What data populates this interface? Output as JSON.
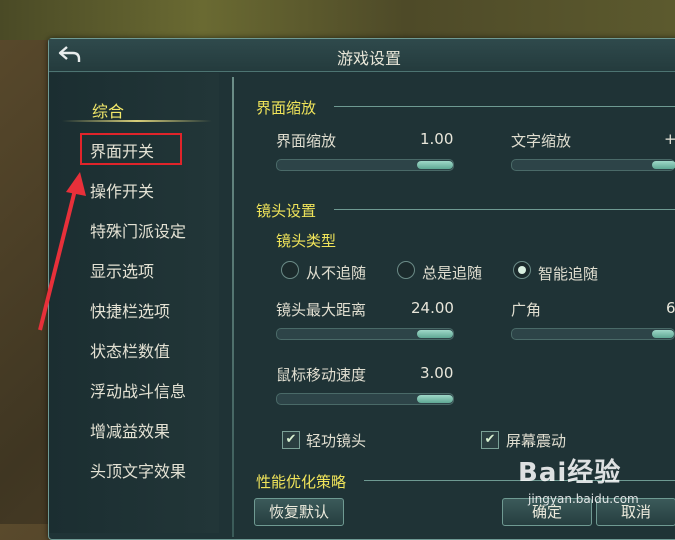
{
  "window": {
    "title": "游戏设置"
  },
  "sidebar": {
    "items": [
      {
        "label": "综合",
        "active": true
      },
      {
        "label": "界面开关",
        "highlighted": true
      },
      {
        "label": "操作开关"
      },
      {
        "label": "特殊门派设定"
      },
      {
        "label": "显示选项"
      },
      {
        "label": "快捷栏选项"
      },
      {
        "label": "状态栏数值"
      },
      {
        "label": "浮动战斗信息"
      },
      {
        "label": "增减益效果"
      },
      {
        "label": "头顶文字效果"
      }
    ]
  },
  "ui_scale": {
    "title": "界面缩放",
    "interface_scale": {
      "label": "界面缩放",
      "value": "1.00"
    },
    "text_scale": {
      "label": "文字缩放",
      "value": "+"
    }
  },
  "camera": {
    "title": "镜头设置",
    "type_title": "镜头类型",
    "options": [
      {
        "label": "从不追随",
        "selected": false
      },
      {
        "label": "总是追随",
        "selected": false
      },
      {
        "label": "智能追随",
        "selected": true
      }
    ],
    "max_distance": {
      "label": "镜头最大距离",
      "value": "24.00"
    },
    "fov": {
      "label": "广角",
      "value": "6"
    },
    "mouse_speed": {
      "label": "鼠标移动速度",
      "value": "3.00"
    },
    "qinggong_camera": {
      "label": "轻功镜头",
      "checked": true
    },
    "screen_shake": {
      "label": "屏幕震动",
      "checked": true
    }
  },
  "performance": {
    "title": "性能优化策略"
  },
  "buttons": {
    "restore": "恢复默认",
    "ok": "确定",
    "cancel": "取消"
  },
  "watermark": {
    "text": "Bai经验",
    "sub": "jingyan.baidu.com"
  },
  "colors": {
    "section_title": "#f0e45a",
    "highlight_box": "#e0242a",
    "arrow": "#e8303a"
  }
}
